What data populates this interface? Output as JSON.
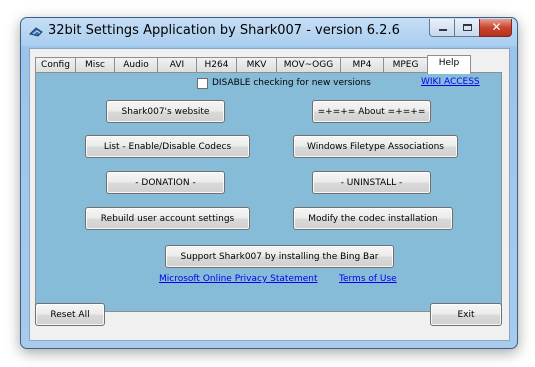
{
  "window": {
    "title": "32bit Settings Application by Shark007 - version 6.2.6",
    "close_symbol": "✕"
  },
  "tabs": [
    {
      "label": "Config"
    },
    {
      "label": "Misc"
    },
    {
      "label": "Audio"
    },
    {
      "label": "AVI"
    },
    {
      "label": "H264"
    },
    {
      "label": "MKV"
    },
    {
      "label": "MOV~OGG"
    },
    {
      "label": "MP4"
    },
    {
      "label": "MPEG"
    },
    {
      "label": "Help",
      "active": true
    }
  ],
  "help": {
    "disable_check_label": "DISABLE checking for new versions",
    "wiki_link": "WIKI   ACCESS",
    "buttons": {
      "website": "Shark007's website",
      "about": "=+=+= About =+=+=",
      "list_codecs": "List - Enable/Disable Codecs",
      "file_assoc": "Windows Filetype Associations",
      "donation": "- DONATION -",
      "uninstall": "- UNINSTALL -",
      "rebuild": "Rebuild user account settings",
      "modify": "Modify the codec installation",
      "bing": "Support Shark007 by installing the Bing Bar"
    },
    "privacy_link": "Microsoft Online Privacy Statement",
    "terms_link": "Terms of Use"
  },
  "footer": {
    "reset_label": "Reset All",
    "exit_label": "Exit"
  },
  "colors": {
    "panel": "#87bcd9",
    "frame": "#a9cdef",
    "link": "#0000ee",
    "close": "#c9452f"
  }
}
